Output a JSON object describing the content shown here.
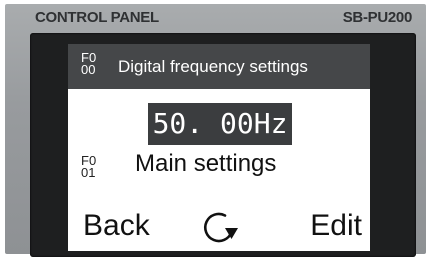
{
  "header": {
    "panel_label": "CONTROL PANEL",
    "model": "SB-PU200"
  },
  "screen": {
    "param_top": {
      "code_line1": "F0",
      "code_line2": "00",
      "name": "Digital frequency settings"
    },
    "value": "50. 00Hz",
    "param_next": {
      "code_line1": "F0",
      "code_line2": "01",
      "name": "Main settings"
    },
    "softkeys": {
      "left": "Back",
      "right": "Edit",
      "center_icon": "rotate-clockwise-icon"
    }
  },
  "colors": {
    "panel": "#9a9da0",
    "bezel": "#1e1f20",
    "highlight": "#454749",
    "screen_bg": "#ffffff"
  }
}
